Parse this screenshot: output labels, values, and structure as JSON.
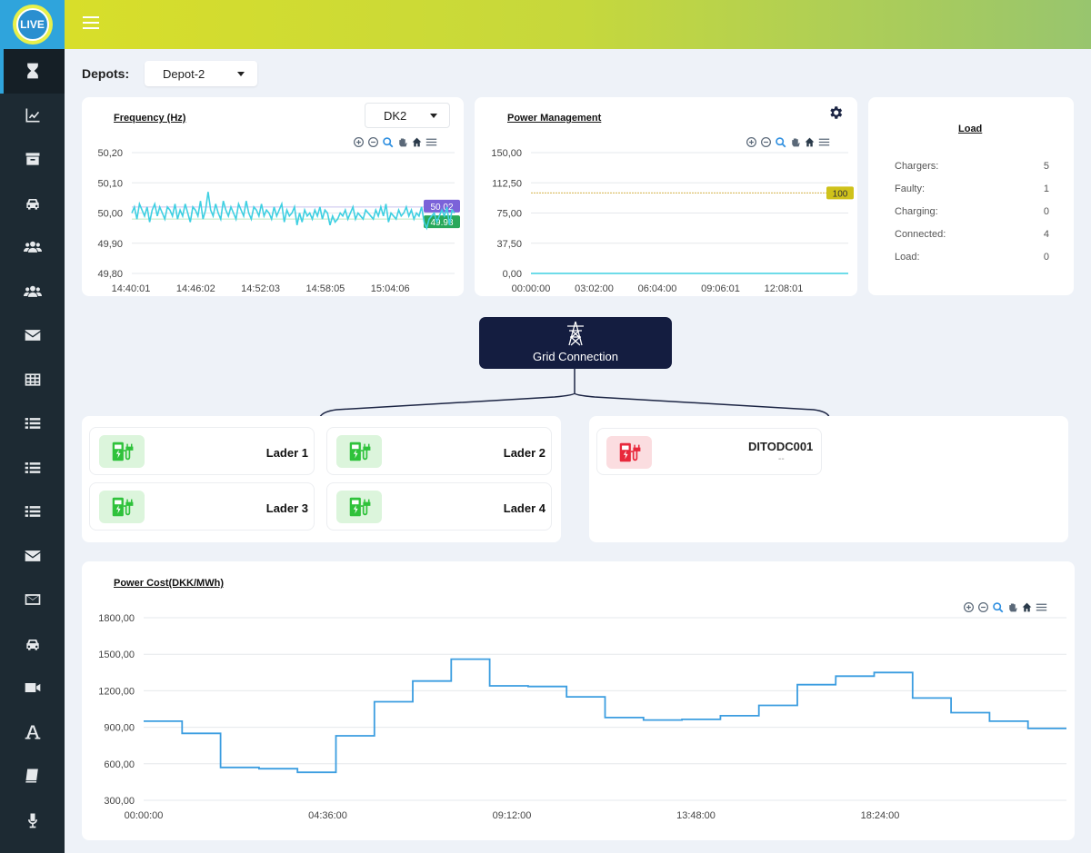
{
  "logo": {
    "text": "LIVE"
  },
  "sidebar": {
    "items": [
      {
        "icon": "hourglass-icon",
        "active": true
      },
      {
        "icon": "chart-line-icon"
      },
      {
        "icon": "archive-icon"
      },
      {
        "icon": "car-icon"
      },
      {
        "icon": "users-icon"
      },
      {
        "icon": "users-icon"
      },
      {
        "icon": "envelope-icon"
      },
      {
        "icon": "table-icon"
      },
      {
        "icon": "list-icon"
      },
      {
        "icon": "list-icon"
      },
      {
        "icon": "list-icon"
      },
      {
        "icon": "envelope-icon"
      },
      {
        "icon": "envelope-outline-icon"
      },
      {
        "icon": "car-icon"
      },
      {
        "icon": "video-icon"
      },
      {
        "icon": "font-icon"
      },
      {
        "icon": "book-icon"
      },
      {
        "icon": "microphone-icon"
      }
    ]
  },
  "depots": {
    "label": "Depots:",
    "selected": "Depot-2"
  },
  "frequency": {
    "title": "Frequency (Hz)",
    "select": "DK2",
    "badge_top": "50.02",
    "badge_bottom": "49.98"
  },
  "power_management": {
    "title": "Power Management",
    "badge": "100"
  },
  "load": {
    "title": "Load",
    "rows": [
      {
        "label": "Chargers:",
        "value": "5"
      },
      {
        "label": "Faulty:",
        "value": "1"
      },
      {
        "label": "Charging:",
        "value": "0"
      },
      {
        "label": "Connected:",
        "value": "4"
      },
      {
        "label": "Load:",
        "value": "0"
      }
    ]
  },
  "grid": {
    "label": "Grid Connection"
  },
  "chargers": [
    {
      "name": "Lader 1"
    },
    {
      "name": "Lader 2"
    },
    {
      "name": "Lader 3"
    },
    {
      "name": "Lader 4"
    }
  ],
  "faulty_charger": {
    "name": "DITODC001",
    "status": "--"
  },
  "power_cost": {
    "title": "Power Cost(DKK/MWh)"
  },
  "colors": {
    "accent": "#2fa4dc",
    "freq_line": "#3fd0e2",
    "cost_line": "#3b9de0",
    "charger_ok": "#2fc23b",
    "charger_fault": "#e8293c"
  },
  "chart_data": [
    {
      "type": "line",
      "title": "Frequency (Hz)",
      "x_ticks": [
        "14:40:01",
        "14:46:02",
        "14:52:03",
        "14:58:05",
        "15:04:06"
      ],
      "y_ticks": [
        "50,20",
        "50,10",
        "50,00",
        "49,90",
        "49,80"
      ],
      "ylim": [
        49.8,
        50.2
      ],
      "annotations": [
        50.02,
        49.98
      ],
      "series": [
        {
          "values": [
            50.0,
            50.02,
            49.98,
            50.03,
            50.01,
            49.99,
            50.02,
            49.97,
            50.01,
            50.03,
            49.99,
            50.02,
            50.0,
            49.98,
            50.02,
            50.01,
            49.99,
            50.03,
            49.98,
            50.01,
            49.99,
            50.03,
            50.0,
            49.97,
            50.02,
            50.01,
            49.99,
            50.04,
            49.98,
            50.01,
            50.07,
            50.01,
            49.99,
            50.03,
            50.0,
            49.98,
            50.04,
            50.01,
            49.99,
            50.02,
            50.0,
            49.98,
            50.03,
            50.01,
            49.99,
            50.04,
            50.0,
            49.98,
            50.02,
            50.01,
            49.99,
            50.03,
            49.99,
            50.01,
            50.0,
            49.98,
            50.02,
            49.99,
            50.01,
            50.03,
            49.97,
            50.01,
            49.99,
            50.0,
            50.02,
            49.96,
            50.0,
            49.97,
            50.01,
            49.99,
            50.0,
            49.98,
            50.01,
            49.99,
            50.02,
            49.98,
            50.01,
            50.0,
            49.96,
            49.99,
            49.97,
            49.98,
            50.0,
            49.99,
            50.01,
            49.98,
            50.0,
            50.02,
            49.98,
            50.0,
            49.99,
            49.98,
            50.01,
            50.0,
            49.99,
            49.98,
            50.01,
            49.99,
            50.02,
            49.99,
            50.03,
            49.97,
            50.0,
            49.99,
            49.98,
            50.01,
            49.99,
            50.0,
            50.02,
            49.99,
            50.01,
            49.98,
            50.0,
            49.99,
            50.02,
            49.97,
            49.95,
            49.98,
            49.99,
            50.0,
            49.97,
            49.99,
            50.01,
            49.99,
            50.02,
            49.96,
            50.01,
            50.0
          ]
        }
      ]
    },
    {
      "type": "line",
      "title": "Power Management",
      "x_ticks": [
        "00:00:00",
        "03:02:00",
        "06:04:00",
        "09:06:01",
        "12:08:01"
      ],
      "y_ticks": [
        "150,00",
        "112,50",
        "75,00",
        "37,50",
        "0,00"
      ],
      "ylim": [
        0,
        150
      ],
      "threshold": 100,
      "series": [
        {
          "values": [
            0,
            0
          ]
        }
      ]
    },
    {
      "type": "line",
      "title": "Power Cost(DKK/MWh)",
      "x_ticks": [
        "00:00:00",
        "04:36:00",
        "09:12:00",
        "13:48:00",
        "18:24:00"
      ],
      "y_ticks": [
        "1800,00",
        "1500,00",
        "1200,00",
        "900,00",
        "600,00",
        "300,00"
      ],
      "ylim": [
        300,
        1800
      ],
      "step": true,
      "series": [
        {
          "values": [
            950,
            850,
            570,
            560,
            530,
            830,
            1110,
            1280,
            1460,
            1240,
            1235,
            1150,
            980,
            960,
            965,
            995,
            1080,
            1250,
            1320,
            1350,
            1140,
            1020,
            950,
            890
          ]
        }
      ]
    }
  ]
}
